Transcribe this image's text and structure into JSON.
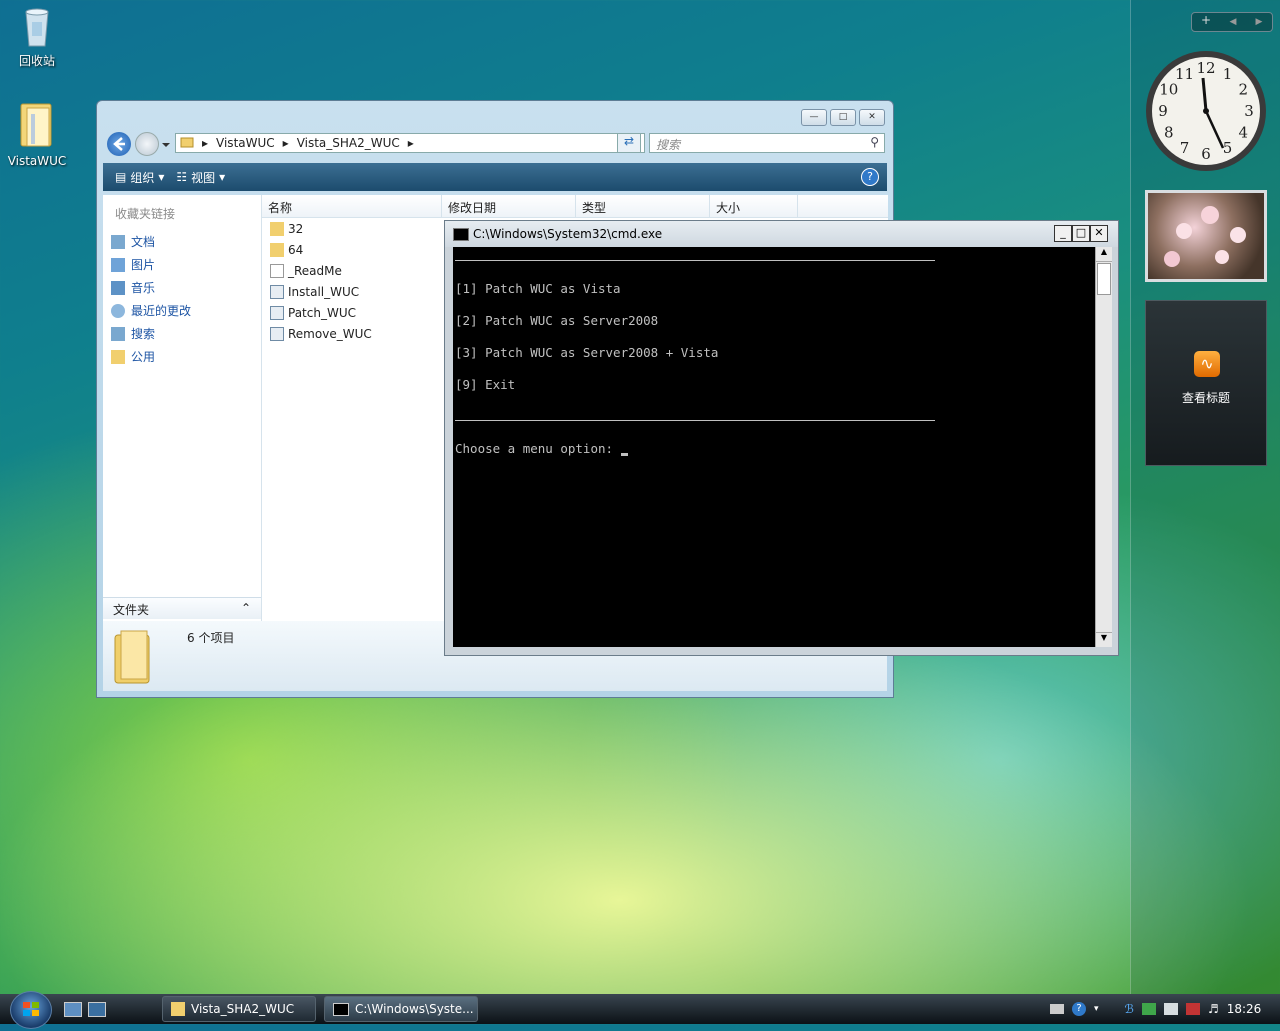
{
  "desktop": {
    "icons": [
      {
        "label": "回收站"
      },
      {
        "label": "VistaWUC"
      }
    ]
  },
  "explorer": {
    "breadcrumb": [
      "VistaWUC",
      "Vista_SHA2_WUC"
    ],
    "search_placeholder": "搜索",
    "toolbar": {
      "organize": "组织",
      "views": "视图"
    },
    "nav": {
      "header": "收藏夹链接",
      "links": [
        "文档",
        "图片",
        "音乐",
        "最近的更改",
        "搜索",
        "公用"
      ],
      "folders": "文件夹"
    },
    "columns": [
      "名称",
      "修改日期",
      "类型",
      "大小"
    ],
    "files": [
      {
        "name": "32",
        "kind": "folder"
      },
      {
        "name": "64",
        "kind": "folder"
      },
      {
        "name": "_ReadMe",
        "kind": "text"
      },
      {
        "name": "Install_WUC",
        "kind": "script"
      },
      {
        "name": "Patch_WUC",
        "kind": "script"
      },
      {
        "name": "Remove_WUC",
        "kind": "script"
      }
    ],
    "status": "6 个项目"
  },
  "cmd": {
    "title": "C:\\Windows\\System32\\cmd.exe",
    "lines": [
      "[1] Patch WUC as Vista",
      "[2] Patch WUC as Server2008",
      "[3] Patch WUC as Server2008 + Vista",
      "[9] Exit"
    ],
    "prompt": "Choose a menu option: "
  },
  "sidebar": {
    "clock_numbers": [
      "12",
      "1",
      "2",
      "3",
      "4",
      "5",
      "6",
      "7",
      "8",
      "9",
      "10",
      "11"
    ],
    "feed_label": "查看标题"
  },
  "taskbar": {
    "tasks": [
      "Vista_SHA2_WUC",
      "C:\\Windows\\Syste..."
    ],
    "clock": "18:26"
  }
}
